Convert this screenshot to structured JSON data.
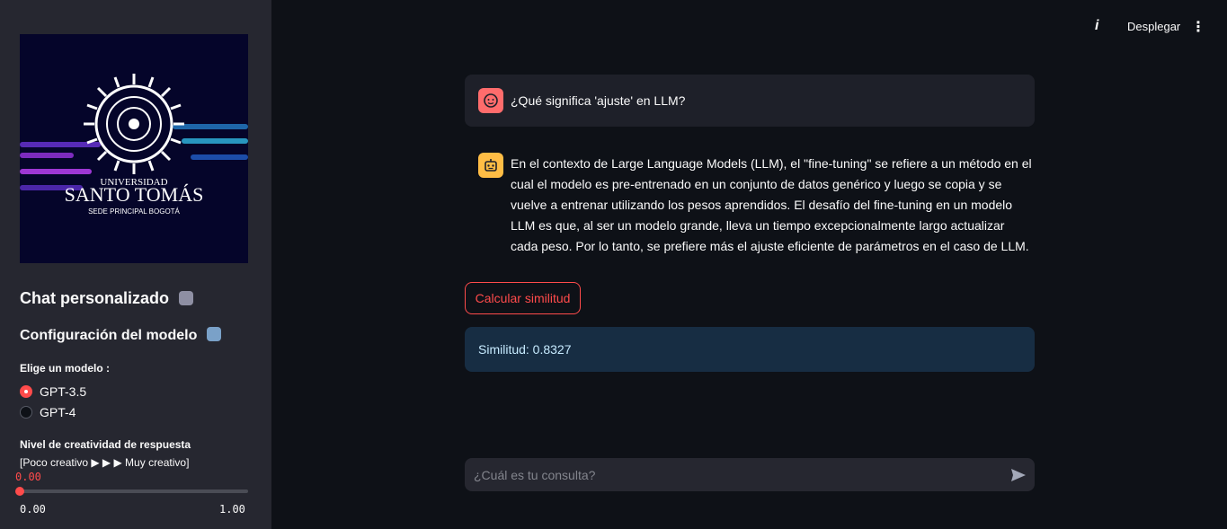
{
  "header": {
    "info_glyph": "i",
    "deploy_label": "Desplegar",
    "menu_glyph": "⋮"
  },
  "sidebar": {
    "logo": {
      "university_line1": "UNIVERSIDAD",
      "university_line2": "SANTO TOMÁS",
      "university_line3": "SEDE PRINCIPAL BOGOTÁ"
    },
    "title": "Chat personalizado",
    "subtitle": "Configuración del modelo",
    "model_label": "Elige un modelo :",
    "models": [
      {
        "label": "GPT-3.5",
        "selected": true
      },
      {
        "label": "GPT-4",
        "selected": false
      }
    ],
    "creativity_label": "Nivel de creatividad de respuesta",
    "creativity_help": "[Poco creativo ▶ ▶ ▶ Muy creativo]",
    "slider": {
      "value": "0.00",
      "min": "0.00",
      "max": "1.00",
      "fraction": 0.0
    }
  },
  "chat": {
    "user_message": "¿Qué significa 'ajuste' en LLM?",
    "bot_message": "En el contexto de Large Language Models (LLM), el \"fine-tuning\" se refiere a un método en el cual el modelo es pre-entrenado en un conjunto de datos genérico y luego se copia y se vuelve a entrenar utilizando los pesos aprendidos. El desafío del fine-tuning en un modelo LLM es que, al ser un modelo grande, lleva un tiempo excepcionalmente largo actualizar cada peso. Por lo tanto, se prefiere más el ajuste eficiente de parámetros en el caso de LLM.",
    "similarity_button": "Calcular similitud",
    "similarity_result": "Similitud: 0.8327",
    "input_placeholder": "¿Cuál es tu consulta?"
  },
  "colors": {
    "accent": "#ff4b4b",
    "sidebar_bg": "#262730",
    "main_bg": "#0e1117",
    "info_bg": "#172d43"
  }
}
